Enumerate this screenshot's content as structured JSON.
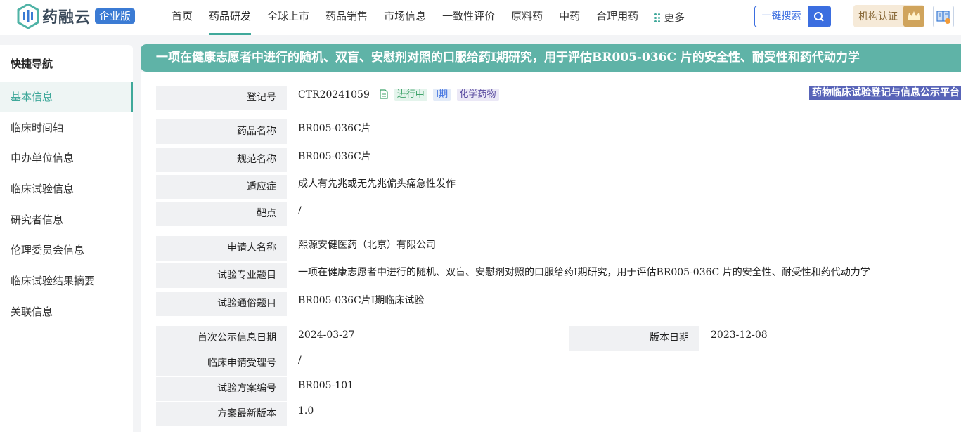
{
  "header": {
    "logo_text": "药融云",
    "logo_badge": "企业版",
    "nav": [
      {
        "label": "首页"
      },
      {
        "label": "药品研发"
      },
      {
        "label": "全球上市"
      },
      {
        "label": "药品销售"
      },
      {
        "label": "市场信息"
      },
      {
        "label": "一致性评价"
      },
      {
        "label": "原料药"
      },
      {
        "label": "中药"
      },
      {
        "label": "合理用药"
      },
      {
        "label": "更多"
      }
    ],
    "active_nav": "药品研发",
    "search_label": "一键搜索",
    "cert_label": "机构认证",
    "accent": "#3fa89a",
    "brand_blue": "#3b6ee0"
  },
  "sidebar": {
    "title": "快捷导航",
    "items": [
      {
        "label": "基本信息"
      },
      {
        "label": "临床时间轴"
      },
      {
        "label": "申办单位信息"
      },
      {
        "label": "临床试验信息"
      },
      {
        "label": "研究者信息"
      },
      {
        "label": "伦理委员会信息"
      },
      {
        "label": "临床试验结果摘要"
      },
      {
        "label": "关联信息"
      }
    ],
    "active": "基本信息"
  },
  "main": {
    "title": "一项在健康志愿者中进行的随机、双盲、安慰剂对照的口服给药I期研究，用于评估BR005-036C 片的安全性、耐受性和药代动力学",
    "registration": {
      "label": "登记号",
      "value": "CTR20241059",
      "tags": [
        "进行中",
        "I期",
        "化学药物"
      ],
      "platform": "药物临床试验登记与信息公示平台"
    },
    "fields": {
      "drug_name": {
        "label": "药品名称",
        "value": "BR005-036C片"
      },
      "standard_name": {
        "label": "规范名称",
        "value": "BR005-036C片"
      },
      "indication": {
        "label": "适应症",
        "value": "成人有先兆或无先兆偏头痛急性发作"
      },
      "target": {
        "label": "靶点",
        "value": "/"
      },
      "applicant": {
        "label": "申请人名称",
        "value": "熙源安健医药（北京）有限公司"
      },
      "professional_title": {
        "label": "试验专业题目",
        "value": "一项在健康志愿者中进行的随机、双盲、安慰剂对照的口服给药I期研究，用于评估BR005-036C 片的安全性、耐受性和药代动力学"
      },
      "popular_title": {
        "label": "试验通俗题目",
        "value": "BR005-036C片I期临床试验"
      },
      "first_public_date": {
        "label": "首次公示信息日期",
        "value": "2024-03-27"
      },
      "version_date": {
        "label": "版本日期",
        "value": "2023-12-08"
      },
      "acceptance_no": {
        "label": "临床申请受理号",
        "value": "/"
      },
      "protocol_no": {
        "label": "试验方案编号",
        "value": "BR005-101"
      },
      "protocol_version": {
        "label": "方案最新版本",
        "value": "1.0"
      }
    }
  }
}
